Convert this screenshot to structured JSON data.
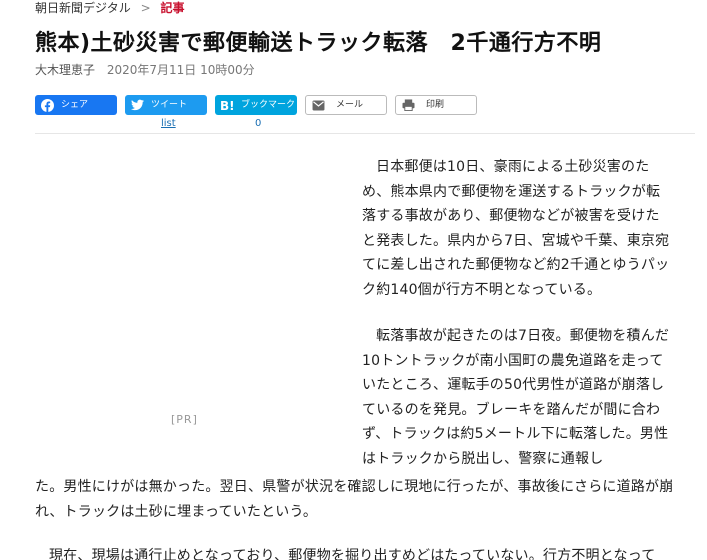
{
  "breadcrumb": {
    "site": "朝日新聞デジタル",
    "separator": ">",
    "current": "記事"
  },
  "article": {
    "headline": "熊本)土砂災害で郵便輸送トラック転落　2千通行方不明",
    "author": "大木理恵子",
    "date": "2020年7月11日 10時00分",
    "paragraph_1": "日本郵便は10日、豪雨による土砂災害のため、熊本県内で郵便物を運送するトラックが転落する事故があり、郵便物などが被害を受けたと発表した。県内から7日、宮城や千葉、東京宛てに差し出された郵便物など約2千通とゆうパック約140個が行方不明となっている。",
    "paragraph_2a": "転落事故が起きたのは7日夜。郵便物を積んだ10トントラックが南小国町の農免道路を走っていたところ、運転手の50代男性が道路が崩落しているのを発見。ブレーキを踏んだが間に合わず、トラックは約5メートル下に転落した。男性はトラックから脱出し、警察に通報し",
    "paragraph_2b": "た。男性にけがは無かった。翌日、県警が状況を確認しに現地に行ったが、事故後にさらに道路が崩れ、トラックは土砂に埋まっていたという。",
    "paragraph_3": "現在、現場は通行止めとなっており、郵便物を掘り出すめどはたっていない。行方不明となって"
  },
  "share": {
    "facebook_label": "シェア",
    "twitter_label": "ツイート",
    "twitter_count": "list",
    "hatena_label": "ブックマーク",
    "hatena_count": "0",
    "mail_label": "メール",
    "print_label": "印刷"
  },
  "ad": {
    "label": "[PR]"
  },
  "colors": {
    "facebook": "#1877f2",
    "twitter": "#1d9bf0",
    "hatena": "#00a4de",
    "breadcrumb_current": "#c8102e"
  },
  "icons": {
    "facebook": "facebook-icon",
    "twitter": "twitter-icon",
    "hatena": "hatena-bookmark-icon",
    "mail": "mail-icon",
    "print": "print-icon"
  }
}
